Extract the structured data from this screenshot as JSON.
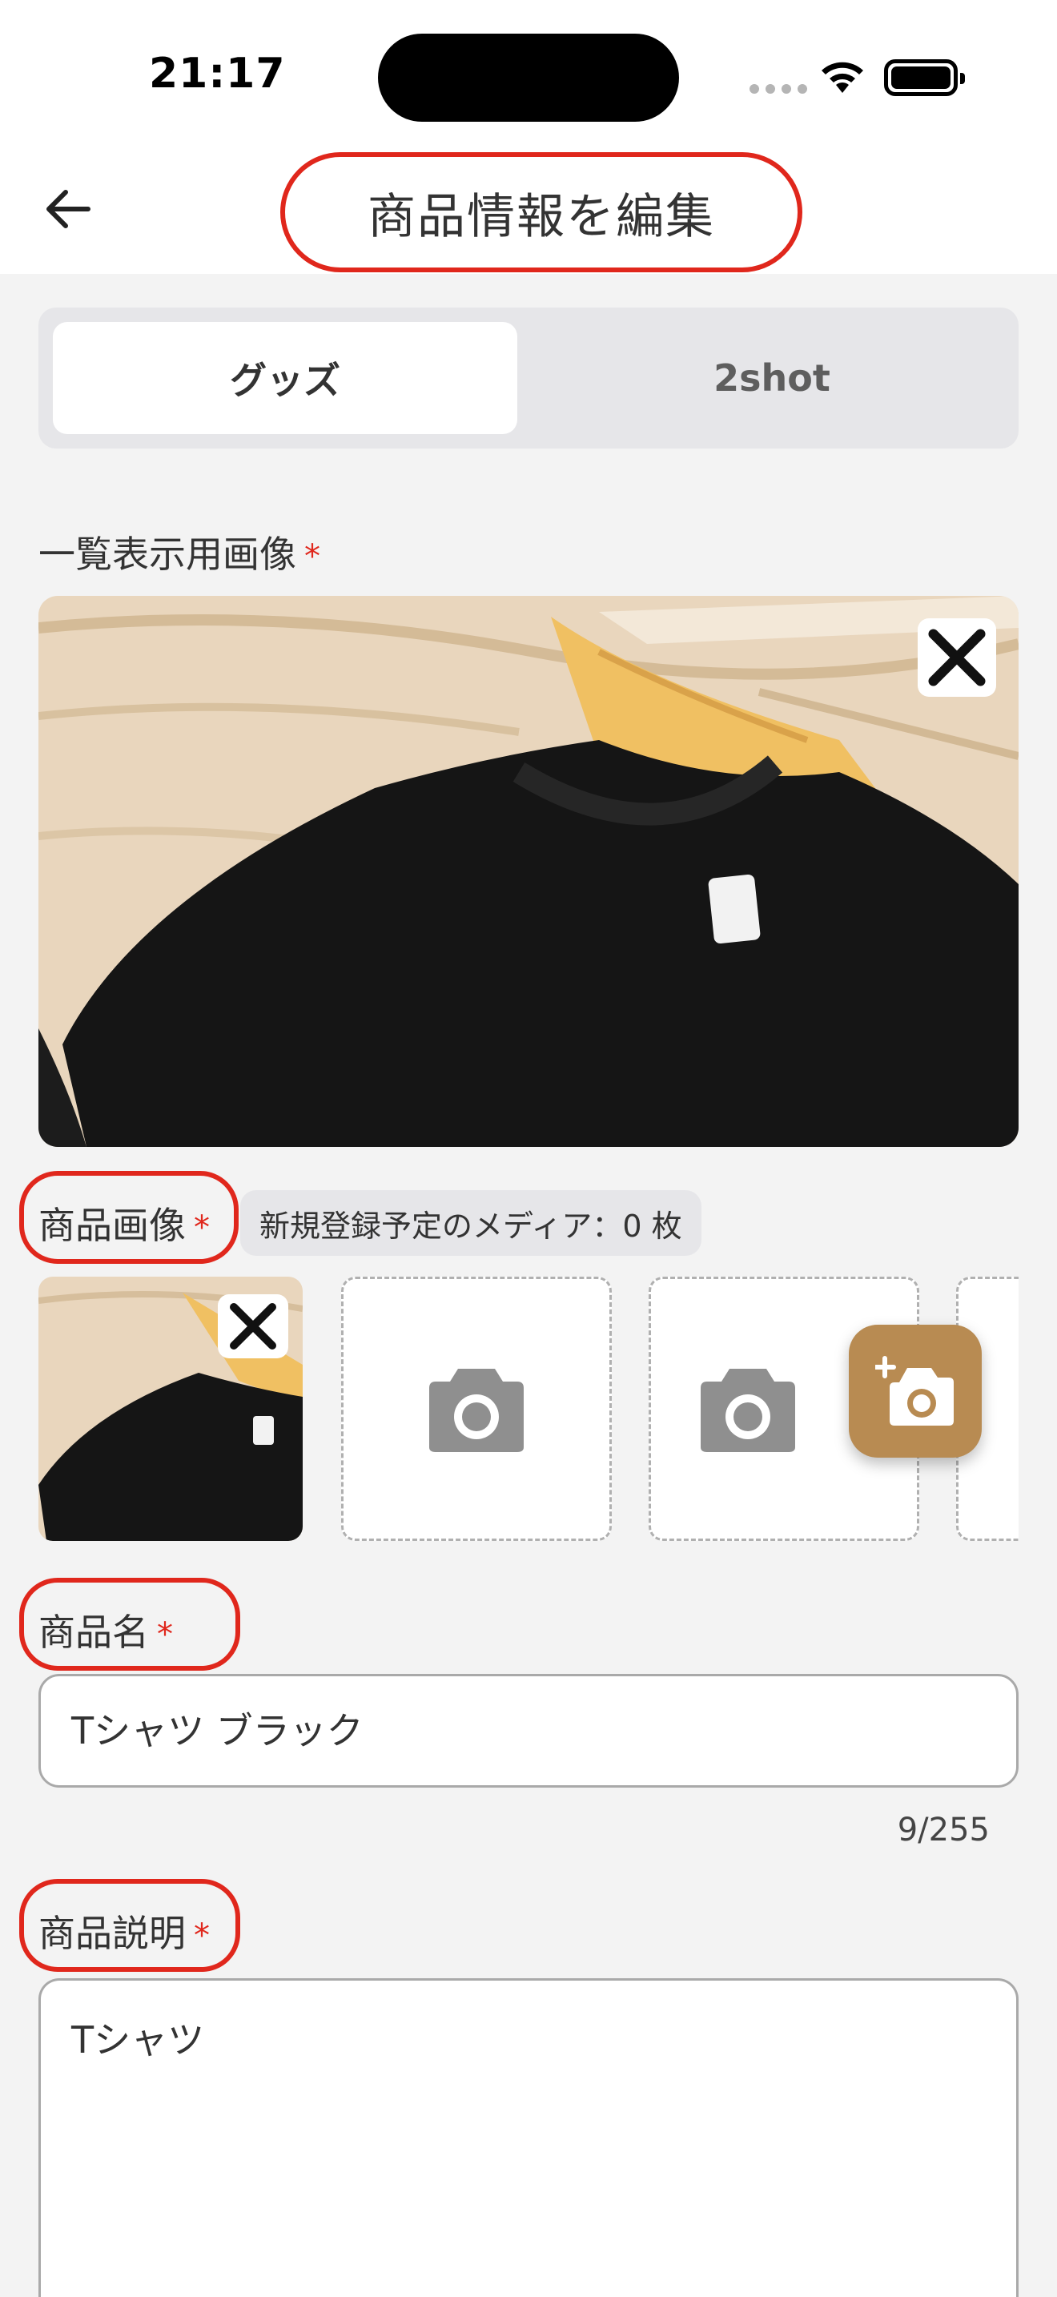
{
  "status": {
    "time": "21:17"
  },
  "header": {
    "title": "商品情報を編集"
  },
  "tabs": [
    {
      "label": "グッズ",
      "selected": true
    },
    {
      "label": "2shot",
      "selected": false
    }
  ],
  "list_image": {
    "label": "一覧表示用画像",
    "required_mark": "*"
  },
  "product_images": {
    "label": "商品画像",
    "required_mark": "*",
    "badge": "新規登録予定のメディア：0 枚"
  },
  "product_name": {
    "label": "商品名",
    "required_mark": "*",
    "value": "Tシャツ ブラック",
    "counter": "9/255"
  },
  "product_description": {
    "label": "商品説明",
    "required_mark": "*",
    "value": "Tシャツ"
  },
  "icons": {
    "back": "arrow-left-icon",
    "remove": "close-icon",
    "camera": "camera-icon",
    "add_photo": "add-photo-icon"
  },
  "colors": {
    "accent": "#b88b52",
    "required": "#e0271c",
    "annotation_ring": "#e0271c"
  }
}
